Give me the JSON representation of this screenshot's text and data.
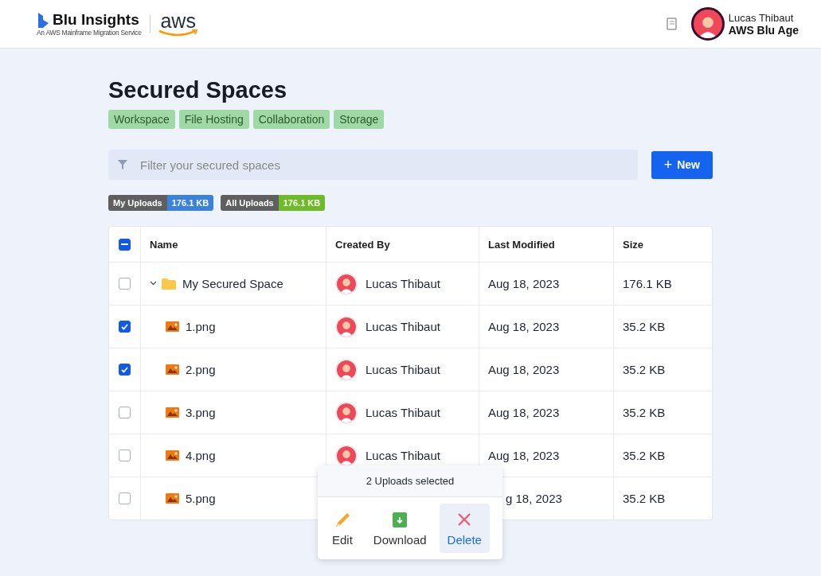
{
  "header": {
    "brand": "Blu Insights",
    "tagline": "An AWS Mainframe Migration Service",
    "partner": "aws",
    "user": {
      "name": "Lucas Thibaut",
      "org": "AWS Blu Age"
    }
  },
  "page": {
    "title": "Secured Spaces",
    "tags": [
      "Workspace",
      "File Hosting",
      "Collaboration",
      "Storage"
    ]
  },
  "filter": {
    "placeholder": "Filter your secured spaces"
  },
  "new_button": {
    "icon": "+",
    "label": "New"
  },
  "usage": [
    {
      "label": "My Uploads",
      "value": "176.1 KB",
      "color": "#3b82e0"
    },
    {
      "label": "All Uploads",
      "value": "176.1 KB",
      "color": "#6cbb27"
    }
  ],
  "table": {
    "header_checkbox": {
      "indeterminate": true
    },
    "columns": [
      "Name",
      "Created By",
      "Last Modified",
      "Size"
    ],
    "rows": [
      {
        "kind": "folder",
        "name": "My Secured Space",
        "expanded": true,
        "checked": false,
        "created_by": "Lucas Thibaut",
        "modified": "Aug 18, 2023",
        "size": "176.1 KB",
        "children": [
          {
            "kind": "image",
            "name": "1.png",
            "checked": true,
            "created_by": "Lucas Thibaut",
            "modified": "Aug 18, 2023",
            "size": "35.2 KB"
          },
          {
            "kind": "image",
            "name": "2.png",
            "checked": true,
            "created_by": "Lucas Thibaut",
            "modified": "Aug 18, 2023",
            "size": "35.2 KB"
          },
          {
            "kind": "image",
            "name": "3.png",
            "checked": false,
            "created_by": "Lucas Thibaut",
            "modified": "Aug 18, 2023",
            "size": "35.2 KB"
          },
          {
            "kind": "image",
            "name": "4.png",
            "checked": false,
            "created_by": "Lucas Thibaut",
            "modified": "Aug 18, 2023",
            "size": "35.2 KB"
          },
          {
            "kind": "image",
            "name": "5.png",
            "checked": false,
            "modified": "g 18, 2023",
            "size": "35.2 KB"
          }
        ]
      }
    ]
  },
  "selection_popup": {
    "title": "2 Uploads selected",
    "actions": [
      {
        "kind": "edit",
        "label": "Edit",
        "selected": false
      },
      {
        "kind": "download",
        "label": "Download",
        "selected": false
      },
      {
        "kind": "delete",
        "label": "Delete",
        "selected": true
      }
    ]
  }
}
